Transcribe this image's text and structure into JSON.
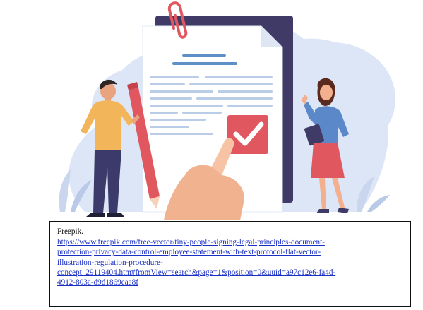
{
  "caption": {
    "credit": "Freepik.",
    "url_lines": [
      "https://www.freepik.com/free-vector/tiny-people-signing-legal-principles-document-",
      "protection-privacy-data-control-employee-statement-with-text-protocol-flat-vector-",
      "illustration-regulation-procedure-",
      "concept_29119404.htm#fromView=search&page=1&position=0&uuid=a97c12e6-fa4d-",
      "4912-803a-d9d1869eaa8f"
    ]
  },
  "colors": {
    "background_blob": "#dde6f6",
    "document_back": "#3f3b66",
    "document_front": "#ffffff",
    "accent_red": "#e0575f",
    "text_line_blue": "#5f8fc7",
    "link": "#1a2fc4"
  },
  "icons": [
    "paperclip-icon",
    "checkmark-icon",
    "pencil-icon"
  ]
}
